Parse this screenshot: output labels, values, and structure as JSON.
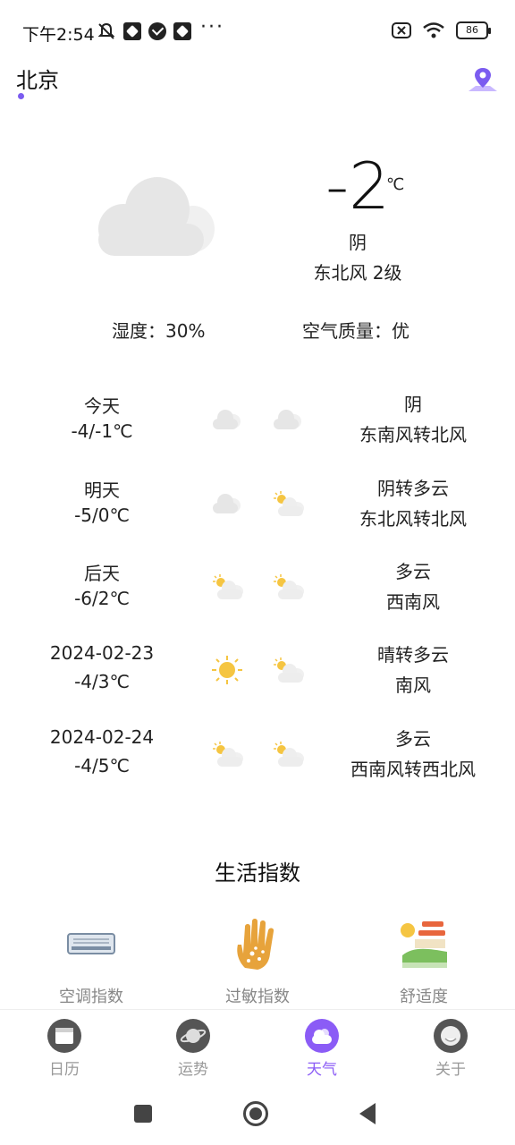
{
  "status_bar": {
    "time": "下午2:54",
    "battery": "86",
    "icons": [
      "mute-icon",
      "app-icon",
      "check-icon",
      "app-icon",
      "more-icon",
      "sim-icon",
      "wifi-icon",
      "battery-icon"
    ]
  },
  "header": {
    "city": "北京",
    "map_icon": "map-pin-icon"
  },
  "current": {
    "temperature": "-2",
    "unit": "℃",
    "condition": "阴",
    "wind": "东北风 2级",
    "humidity": "湿度：30%",
    "air_quality": "空气质量：优",
    "icon": "cloud-icon"
  },
  "forecast": [
    {
      "date": "今天",
      "range": "-4/-1℃",
      "day_icon": "cloud-icon",
      "night_icon": "cloud-icon",
      "condition": "阴",
      "wind": "东南风转北风"
    },
    {
      "date": "明天",
      "range": "-5/0℃",
      "day_icon": "cloud-icon",
      "night_icon": "partly-cloudy-icon",
      "condition": "阴转多云",
      "wind": "东北风转北风"
    },
    {
      "date": "后天",
      "range": "-6/2℃",
      "day_icon": "partly-cloudy-icon",
      "night_icon": "partly-cloudy-icon",
      "condition": "多云",
      "wind": "西南风"
    },
    {
      "date": "2024-02-23",
      "range": "-4/3℃",
      "day_icon": "sun-icon",
      "night_icon": "partly-cloudy-icon",
      "condition": "晴转多云",
      "wind": "南风"
    },
    {
      "date": "2024-02-24",
      "range": "-4/5℃",
      "day_icon": "partly-cloudy-icon",
      "night_icon": "partly-cloudy-icon",
      "condition": "多云",
      "wind": "西南风转西北风"
    }
  ],
  "life_index": {
    "title": "生活指数",
    "items": [
      {
        "label": "空调指数",
        "icon": "air-conditioner-icon"
      },
      {
        "label": "过敏指数",
        "icon": "allergy-hand-icon"
      },
      {
        "label": "舒适度",
        "icon": "comfort-landscape-icon"
      }
    ]
  },
  "bottom_nav": {
    "items": [
      {
        "label": "日历",
        "icon": "calendar-icon"
      },
      {
        "label": "运势",
        "icon": "planet-icon"
      },
      {
        "label": "天气",
        "icon": "weather-icon"
      },
      {
        "label": "关于",
        "icon": "about-icon"
      }
    ],
    "active": "天气"
  },
  "colors": {
    "accent": "#8b5cf6",
    "text": "#222222",
    "muted": "#888888",
    "cloud": "#e6e6e6",
    "sun": "#f5c542"
  }
}
